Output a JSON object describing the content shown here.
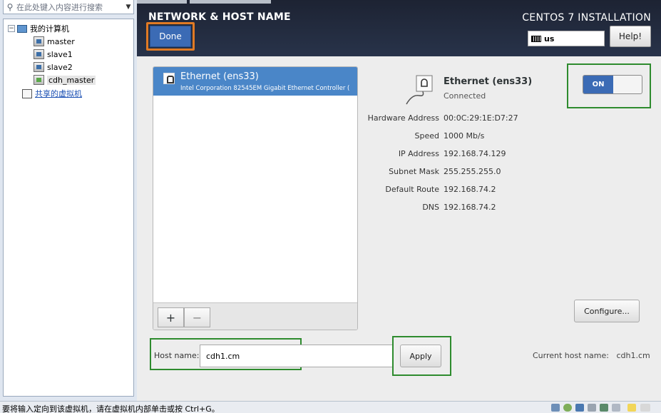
{
  "sidebar": {
    "search_placeholder": "在此处键入内容进行搜索",
    "root_label": "我的计算机",
    "vms": [
      "master",
      "slave1",
      "slave2",
      "cdh_master"
    ],
    "shared_label": "共享的虚拟机"
  },
  "header": {
    "title": "NETWORK & HOST NAME",
    "done_label": "Done",
    "install_title": "CENTOS 7 INSTALLATION",
    "keyboard_layout": "us",
    "help_label": "Help!"
  },
  "connection": {
    "name": "Ethernet (ens33)",
    "description": "Intel Corporation 82545EM Gigabit Ethernet Controller (",
    "add_label": "+",
    "remove_label": "−"
  },
  "details": {
    "name": "Ethernet (ens33)",
    "status": "Connected",
    "rows": [
      {
        "key": "Hardware Address",
        "value": "00:0C:29:1E:D7:27"
      },
      {
        "key": "Speed",
        "value": "1000 Mb/s"
      },
      {
        "key": "IP Address",
        "value": "192.168.74.129"
      },
      {
        "key": "Subnet Mask",
        "value": "255.255.255.0"
      },
      {
        "key": "Default Route",
        "value": "192.168.74.2"
      },
      {
        "key": "DNS",
        "value": "192.168.74.2"
      }
    ],
    "toggle_label": "ON",
    "configure_label": "Configure..."
  },
  "hostname": {
    "label": "Host name:",
    "value": "cdh1.cm",
    "apply_label": "Apply",
    "current_label": "Current host name:",
    "current_value": "cdh1.cm"
  },
  "statusbar": {
    "text": "要将输入定向到该虚拟机，请在虚拟机内部单击或按 Ctrl+G。"
  }
}
